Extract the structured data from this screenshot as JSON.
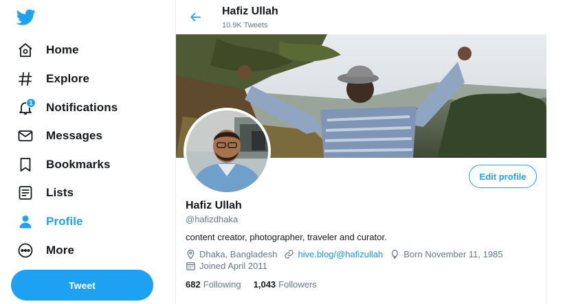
{
  "sidebar": {
    "items": [
      {
        "label": "Home",
        "icon": "home-icon"
      },
      {
        "label": "Explore",
        "icon": "hashtag-icon"
      },
      {
        "label": "Notifications",
        "icon": "bell-icon",
        "badge": "1"
      },
      {
        "label": "Messages",
        "icon": "envelope-icon"
      },
      {
        "label": "Bookmarks",
        "icon": "bookmark-icon"
      },
      {
        "label": "Lists",
        "icon": "list-icon"
      },
      {
        "label": "Profile",
        "icon": "person-icon",
        "active": true
      },
      {
        "label": "More",
        "icon": "more-icon"
      }
    ],
    "tweet_button": "Tweet"
  },
  "header": {
    "name": "Hafiz Ullah",
    "tweet_count": "10.9K Tweets"
  },
  "profile": {
    "name": "Hafiz Ullah",
    "handle": "@hafizdhaka",
    "bio": "content creator, photographer, traveler and curator.",
    "location": "Dhaka, Bangladesh",
    "website": "hive.blog/@hafizullah",
    "birthday": "Born November 11, 1985",
    "joined": "Joined April 2011",
    "following_count": "682",
    "following_label": "Following",
    "followers_count": "1,043",
    "followers_label": "Followers",
    "edit_button": "Edit profile"
  },
  "colors": {
    "accent": "#1da1f2",
    "text": "#14171a",
    "muted": "#657786",
    "border": "#e6ecf0"
  }
}
